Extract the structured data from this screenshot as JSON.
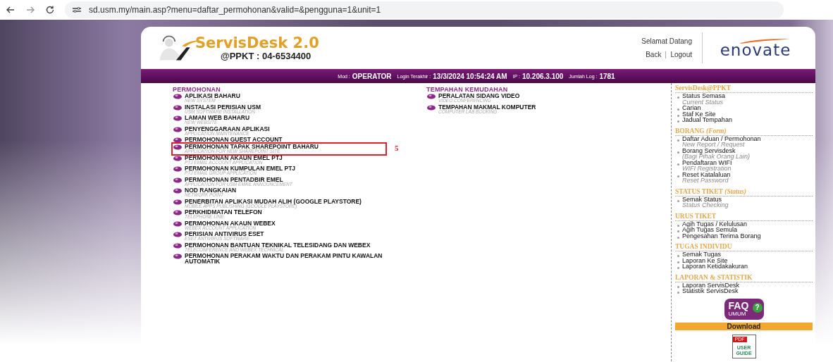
{
  "browser": {
    "url": "sd.usm.my/main.asp?menu=daftar_permohonan&valid=&pengguna=1&unit=1"
  },
  "header": {
    "logo_title": "ServisDesk 2.0",
    "logo_phone": "@PPKT : 04-6534400",
    "welcome": "Selamat Datang",
    "links": [
      "Back",
      "Logout"
    ],
    "partner_logo": "enovate"
  },
  "info_bar": [
    {
      "label": "Mod :",
      "value": "OPERATOR"
    },
    {
      "label": "Login Terakhir :",
      "value": "13/3/2024 10:54:24 AM"
    },
    {
      "label": "IP :",
      "value": "10.206.3.100"
    },
    {
      "label": "Jumlah Log :",
      "value": "1781"
    }
  ],
  "columns": [
    {
      "title": "PERMOHONAN",
      "items": [
        {
          "title": "APLIKASI BAHARU",
          "subtitle": "NEW SYSTEM",
          "highlighted": false
        },
        {
          "title": "INSTALASI PERISIAN USM",
          "subtitle": "USM SOFTWARE INSTALLATION",
          "highlighted": false
        },
        {
          "title": "LAMAN WEB BAHARU",
          "subtitle": "NEW WEBSITE",
          "highlighted": false
        },
        {
          "title": "PENYENGGARAAN APLIKASI",
          "subtitle": "APPLICATION MAINTENANCE",
          "highlighted": false
        },
        {
          "title": "PERMOHONAN GUEST ACCOUNT",
          "highlighted": false
        },
        {
          "title": "PERMOHONAN TAPAK SHAREPOINT BAHARU",
          "subtitle": "APPLICATION FOR NEW SHAREPOINT SITE",
          "highlighted": true,
          "annotation": "5"
        },
        {
          "title": "PERMOHONAN AKAUN EMEL PTJ",
          "subtitle": "PTJ EMAIL ACCOUNT APPLICATION",
          "highlighted": false
        },
        {
          "title": "PERMOHONAN KUMPULAN EMEL PTJ",
          "subtitle": "PTJ EMAIL GROUP APPLICATION",
          "highlighted": false
        },
        {
          "title": "PERMOHONAN PENTADBIR EMEL",
          "subtitle": "APPLICATION FOR USM EMAIL ANNOUNCEMENT",
          "highlighted": false
        },
        {
          "title": "NOD RANGKAIAN",
          "subtitle": "NETWORK POINT",
          "highlighted": false
        },
        {
          "title": "PENERBITAN APLIKASI MUDAH ALIH (GOOGLE PLAYSTORE)",
          "subtitle": "MOBILE APPS PUBLISHING (GOOGLE PLAYSTORE)",
          "highlighted": false
        },
        {
          "title": "PERKHIDMATAN TELEFON",
          "subtitle": "TELEPHONE LINE",
          "highlighted": false
        },
        {
          "title": "PERMOHONAN AKAUN WEBEX",
          "subtitle": "WEBEX ACCOUNT APPLICATION",
          "highlighted": false
        },
        {
          "title": "PERISIAN ANTIVIRUS ESET",
          "subtitle": "ESET ANTIVIRUS SOFTWARE",
          "highlighted": false
        },
        {
          "title": "PERMOHONAN BANTUAN TEKNIKAL TELESIDANG DAN WEBEX",
          "subtitle": "TELECONFERENCE AND WEBEX TECHNICAL",
          "highlighted": false
        },
        {
          "title": "PERMOHONAN PERAKAM WAKTU DAN PERAKAM PINTU KAWALAN AUTOMATIK",
          "highlighted": false
        }
      ]
    },
    {
      "title": "TEMPAHAN KEMUDAHAN",
      "items": [
        {
          "title": "PERALATAN SIDANG VIDEO",
          "subtitle": "VIDEO CONFERENCING",
          "highlighted": false
        },
        {
          "title": "TEMPAHAN MAKMAL KOMPUTER",
          "subtitle": "COMPUTER LAB BOOKING",
          "highlighted": false
        }
      ]
    }
  ],
  "sidebar": [
    {
      "title": "ServisDesk@PPKT",
      "links": [
        {
          "text": "Status Semasa",
          "sub": "Current Status"
        },
        {
          "text": "Carian"
        },
        {
          "text": "Staf Ke Site"
        },
        {
          "text": "Jadual Tempahan"
        }
      ]
    },
    {
      "title": "BORANG",
      "title_note": "(Form)",
      "links": [
        {
          "text": "Daftar Aduan / Permohonan",
          "sub": "New Report / Request"
        },
        {
          "text": "Borang Servisdesk",
          "sub": "(Bagi Pihak Orang Lain)"
        },
        {
          "text": "Pendaftaran WIFI",
          "sub": "WIFI Registration"
        },
        {
          "text": "Reset Katalaluan",
          "sub": "Reset Password"
        }
      ]
    },
    {
      "title": "STATUS TIKET",
      "title_note": "(Status)",
      "links": [
        {
          "text": "Semak Status",
          "sub": "Status Checking"
        }
      ]
    },
    {
      "title": "URUS TIKET",
      "links": [
        {
          "text": "Agih Tugas / Kelulusan"
        },
        {
          "text": "Agih Tugas Semula"
        },
        {
          "text": "Pengesahan Terima Borang"
        }
      ]
    },
    {
      "title": "TUGAS INDIVIDU",
      "links": [
        {
          "text": "Semak Tugas"
        },
        {
          "text": "Laporan Ke Site"
        },
        {
          "text": "Laporan Ketidakakuran"
        }
      ]
    },
    {
      "title": "LAPORAN & STATISTIK",
      "links": [
        {
          "text": "Laporan ServisDesk"
        },
        {
          "text": "Statistik ServisDesk"
        }
      ]
    }
  ],
  "faq": {
    "title": "FAQ",
    "sub": "UMUM",
    "mark": "?"
  },
  "download": {
    "label": "Download",
    "file_tag": "PDF",
    "file_label": "USER GUIDE"
  }
}
